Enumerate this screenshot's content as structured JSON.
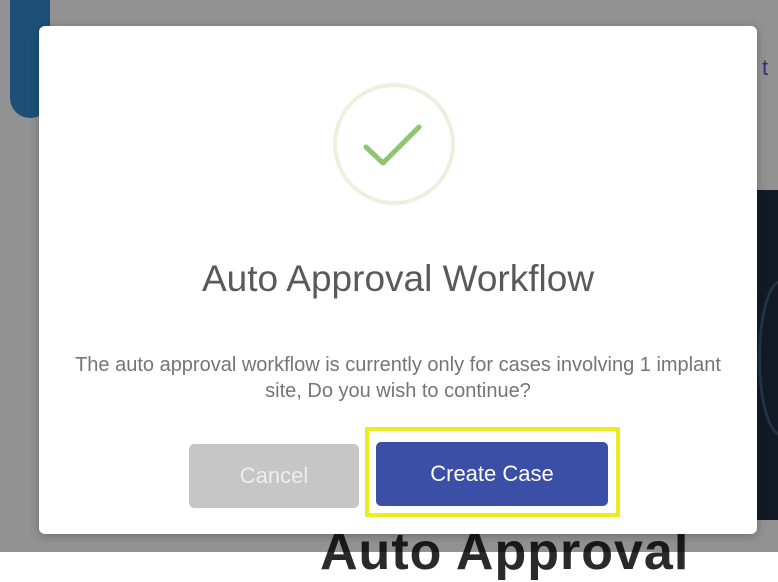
{
  "background": {
    "partial_link_char": "t",
    "partial_heading": "Auto Approval"
  },
  "modal": {
    "icon": "checkmark-success-icon",
    "title": "Auto Approval Workflow",
    "message": "The auto approval workflow is currently only for cases involving 1 implant site, Do you wish to continue?",
    "cancel_label": "Cancel",
    "confirm_label": "Create Case"
  },
  "colors": {
    "checkmark": "#8dc572",
    "icon_ring": "#eaf2df",
    "confirm_button": "#3c4fa6",
    "cancel_button": "#c6c6c6",
    "highlight": "#ecec1e"
  }
}
